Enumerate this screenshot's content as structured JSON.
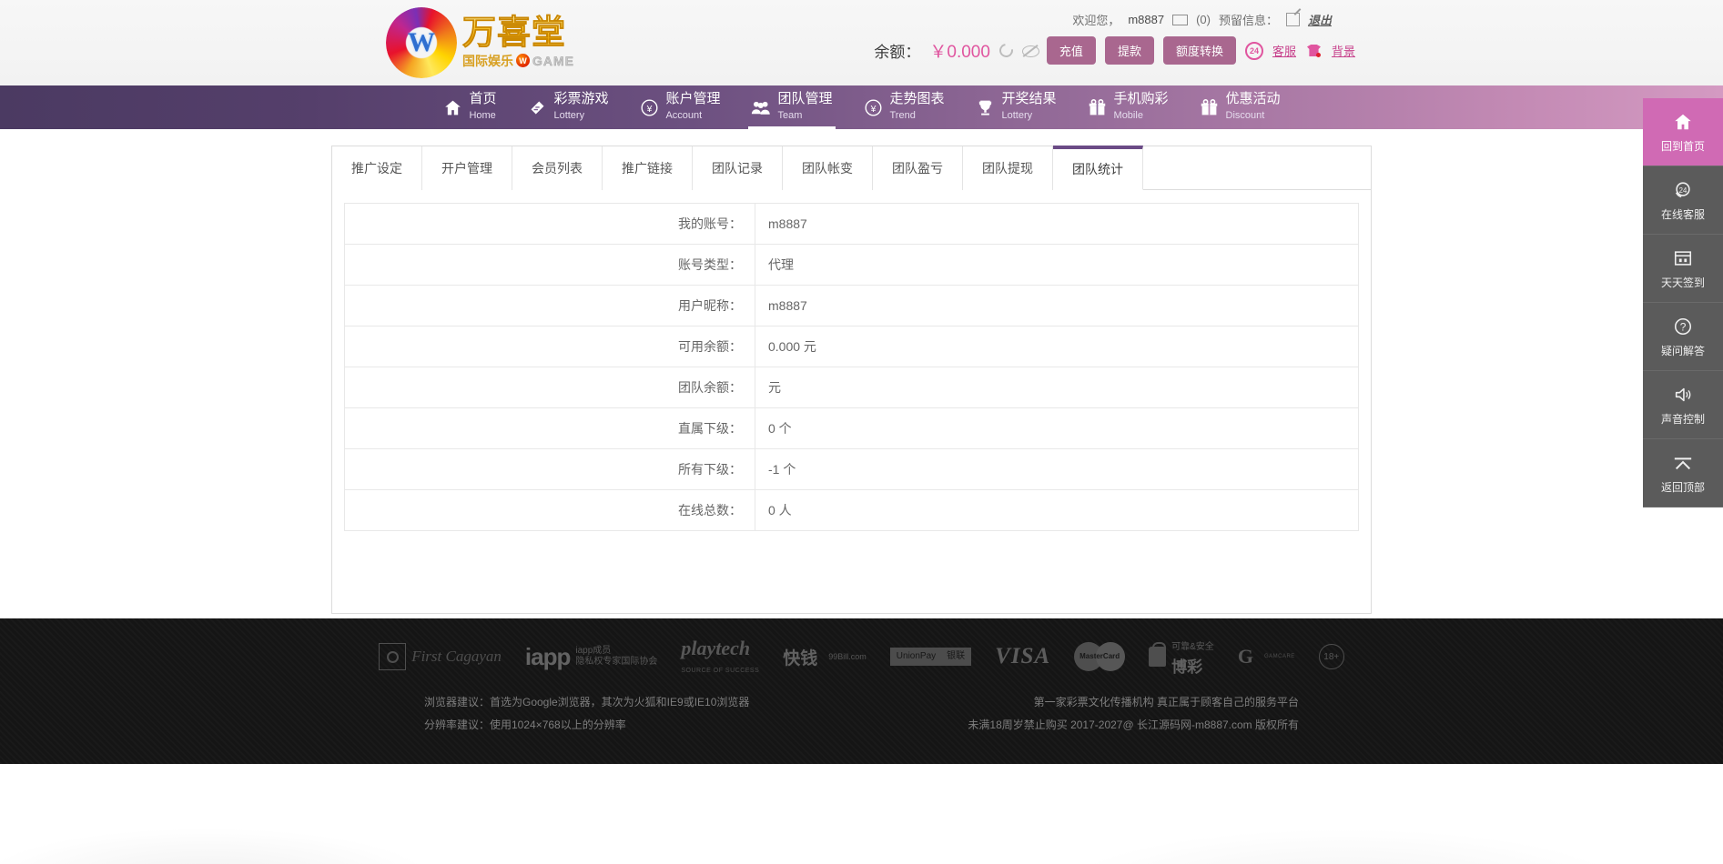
{
  "brand": {
    "logo_main": "万喜堂",
    "logo_sub_cn": "国际娱乐",
    "logo_sub_dot": "W",
    "logo_sub_en": "GAME"
  },
  "header": {
    "welcome_label": "欢迎您，",
    "username": "m8887",
    "mail_count": "(0)",
    "reserved_info_label": "预留信息：",
    "logout_label": "退出",
    "balance_label": "余额：",
    "balance_value": "￥0.000",
    "buttons": [
      {
        "label": "充值",
        "name": "deposit-button"
      },
      {
        "label": "提款",
        "name": "withdraw-button"
      },
      {
        "label": "额度转换",
        "name": "transfer-button"
      }
    ],
    "service_badge": "24",
    "service_label": "客服",
    "theme_label": "背景",
    "accent_pink": "#c7418c",
    "button_purple": "#a9678f"
  },
  "nav": {
    "items": [
      {
        "cn": "首页",
        "en": "Home",
        "icon": "home-icon"
      },
      {
        "cn": "彩票游戏",
        "en": "Lottery",
        "icon": "ticket-icon"
      },
      {
        "cn": "账户管理",
        "en": "Account",
        "icon": "yen-circle-icon"
      },
      {
        "cn": "团队管理",
        "en": "Team",
        "icon": "users-icon"
      },
      {
        "cn": "走势图表",
        "en": "Trend",
        "icon": "yen-circle-icon"
      },
      {
        "cn": "开奖结果",
        "en": "Lottery",
        "icon": "trophy-icon"
      },
      {
        "cn": "手机购彩",
        "en": "Mobile",
        "icon": "gift-icon"
      },
      {
        "cn": "优惠活动",
        "en": "Discount",
        "icon": "gift-icon"
      }
    ],
    "active_index": 3
  },
  "tabs": {
    "items": [
      "推广设定",
      "开户管理",
      "会员列表",
      "推广链接",
      "团队记录",
      "团队帐变",
      "团队盈亏",
      "团队提现",
      "团队统计"
    ],
    "active_index": 8,
    "active_border_color": "#6b4b86"
  },
  "table": {
    "rows": [
      {
        "label": "我的账号：",
        "value": "m8887"
      },
      {
        "label": "账号类型：",
        "value": "代理"
      },
      {
        "label": "用户昵称：",
        "value": "m8887"
      },
      {
        "label": "可用余额：",
        "value": "0.000 元"
      },
      {
        "label": "团队余额：",
        "value": "元"
      },
      {
        "label": "直属下级：",
        "value": "0 个"
      },
      {
        "label": "所有下级：",
        "value": "-1 个"
      },
      {
        "label": "在线总数：",
        "value": "0 人"
      }
    ]
  },
  "rsidebar": {
    "items": [
      {
        "label": "回到首页",
        "icon": "home-icon",
        "active": true
      },
      {
        "label": "在线客服",
        "icon": "headset-24-icon",
        "active": false
      },
      {
        "label": "天天签到",
        "icon": "calendar-icon",
        "active": false
      },
      {
        "label": "疑问解答",
        "icon": "question-circle-icon",
        "active": false
      },
      {
        "label": "声音控制",
        "icon": "speaker-icon",
        "active": false
      },
      {
        "label": "返回顶部",
        "icon": "chevron-up-icon",
        "active": false
      }
    ],
    "active_color": "#d06ab4"
  },
  "footer": {
    "partners": [
      {
        "name": "first-cagayan-logo",
        "text": "First Cagayan"
      },
      {
        "name": "iapp-logo",
        "text": "iapp",
        "sub1": "iapp成员",
        "sub2": "隐私权专家国际协会"
      },
      {
        "name": "playtech-logo",
        "text": "playtech",
        "sub": "SOURCE OF SUCCESS"
      },
      {
        "name": "99bill-logo",
        "text": "快钱",
        "sub": "99Bill.com"
      },
      {
        "name": "unionpay-logo",
        "text": "UnionPay",
        "sub": "银联"
      },
      {
        "name": "visa-logo",
        "text": "VISA"
      },
      {
        "name": "mastercard-logo",
        "text": "MasterCard"
      },
      {
        "name": "bocai-logo",
        "text": "可靠&安全",
        "sub": "博彩"
      },
      {
        "name": "gamcare-logo",
        "text": "G",
        "sub": "GAMCARE"
      },
      {
        "name": "age18-logo",
        "text": "18+"
      }
    ],
    "left_lines": [
      "浏览器建议：首选为Google浏览器，其次为火狐和IE9或IE10浏览器",
      "分辨率建议：使用1024×768以上的分辨率"
    ],
    "right_lines": [
      "第一家彩票文化传播机构 真正属于顾客自己的服务平台",
      "未满18周岁禁止购买 2017-2027@ 长江源码网-m8887.com 版权所有"
    ]
  }
}
